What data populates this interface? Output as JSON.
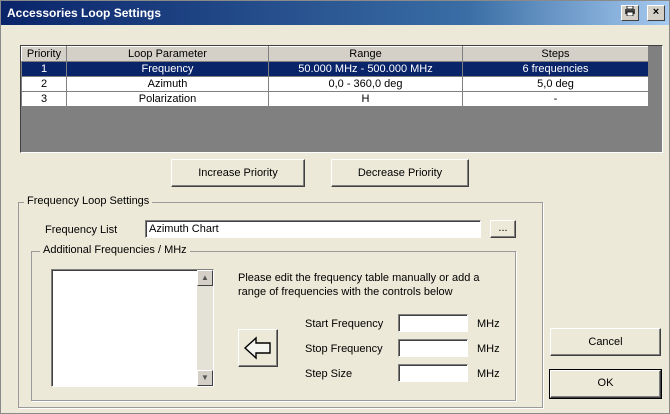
{
  "window": {
    "title": "Accessories Loop Settings",
    "print_icon": "printer-icon",
    "close_glyph": "×"
  },
  "loop_table": {
    "columns": [
      "Priority",
      "Loop Parameter",
      "Range",
      "Steps"
    ],
    "rows": [
      {
        "priority": "1",
        "parameter": "Frequency",
        "range": "50.000 MHz - 500.000 MHz",
        "steps": "6 frequencies",
        "selected": true
      },
      {
        "priority": "2",
        "parameter": "Azimuth",
        "range": "0,0 - 360,0 deg",
        "steps": "5,0 deg"
      },
      {
        "priority": "3",
        "parameter": "Polarization",
        "range": "H",
        "steps": "-"
      }
    ]
  },
  "buttons": {
    "increase_priority": "Increase Priority",
    "decrease_priority": "Decrease Priority",
    "cancel": "Cancel",
    "ok": "OK",
    "browse": "..."
  },
  "frequency_loop": {
    "group_title": "Frequency Loop Settings",
    "frequency_list_label": "Frequency List",
    "frequency_list_value": "Azimuth Chart",
    "additional_title": "Additional Frequencies / MHz",
    "instructions": "Please edit the frequency table manually or add a range of frequencies with the controls below",
    "start_label": "Start Frequency",
    "stop_label": "Stop Frequency",
    "step_label": "Step Size",
    "unit": "MHz",
    "start_value": "",
    "stop_value": "",
    "step_value": ""
  },
  "colors": {
    "title_bar": "#0a246a",
    "selection": "#0a246a",
    "dialog_bg": "#ece9d8"
  }
}
